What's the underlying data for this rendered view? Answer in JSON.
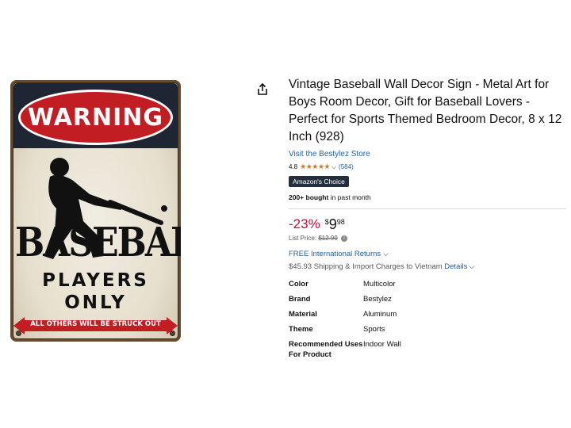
{
  "product": {
    "title": "Vintage Baseball Wall Decor Sign - Metal Art for Boys Room Decor, Gift for Baseball Lovers - Perfect for Sports Themed Bedroom Decor, 8 x 12 Inch (928)",
    "store_link": "Visit the Bestylez Store",
    "rating_value": "4.8",
    "rating_stars": "★★★★★",
    "rating_fraction": 0.96,
    "rating_count": "(584)",
    "badge": "Amazon's Choice",
    "bought_bold": "200+ bought",
    "bought_rest": " in past month",
    "discount": "-23%",
    "price_symbol": "$",
    "price_whole": "9",
    "price_fraction": "98",
    "list_price_label": "List Price: ",
    "list_price_value": "$12.99",
    "returns": "FREE International Returns",
    "shipping_text": "$45.93 Shipping & Import Charges to Vietnam ",
    "shipping_link": "Details"
  },
  "specs": [
    {
      "key": "Color",
      "value": "Multicolor"
    },
    {
      "key": "Brand",
      "value": "Bestylez"
    },
    {
      "key": "Material",
      "value": "Aluminum"
    },
    {
      "key": "Theme",
      "value": "Sports"
    },
    {
      "key": "Recommended Uses For Product",
      "value": "Indoor Wall"
    }
  ],
  "sign": {
    "warning": "WARNING",
    "baseball": "BASEBALL",
    "players": "PLAYERS",
    "only": "ONLY",
    "footer": "ALL OTHERS WILL BE STRUCK OUT"
  },
  "colors": {
    "link": "#2162a1",
    "discount": "#cc0c39",
    "stars": "#e8730d",
    "badge_bg": "#232f3e",
    "sign_red": "#c21d22"
  },
  "icons": {
    "share": "share-icon",
    "chevron": "chevron-down-icon",
    "info": "info-icon"
  }
}
